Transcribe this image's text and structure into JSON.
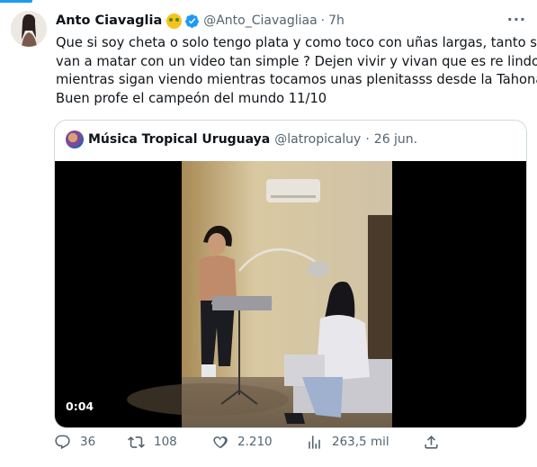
{
  "tweet": {
    "author_name": "Anto Ciavaglia",
    "author_handle": "@Anto_Ciavagliaa",
    "separator": "·",
    "time": "7h",
    "more_label": "···",
    "text_lines": [
      "Que si soy cheta o solo tengo plata y como toco con uñas largas, tanto se",
      "van a matar con un video tan simple ? Dejen vivir y vivan que es re lindo",
      "mientras sigan viendo mientras tocamos unas plenitasss desde la Tahona",
      "Buen profe el campeón del mundo 11/10"
    ],
    "heart_emoji": "♡"
  },
  "quoted": {
    "author_name": "Música Tropical Uruguaya",
    "author_handle": "@latropicaluy",
    "separator": "·",
    "time": "26 jun.",
    "video_duration": "0:04"
  },
  "actions": {
    "replies": "36",
    "retweets": "108",
    "likes": "2.210",
    "views": "263,5 mil"
  },
  "colors": {
    "accent": "#1d9bf0",
    "text": "#0f1419",
    "muted": "#536471",
    "border": "#cfd9de"
  }
}
